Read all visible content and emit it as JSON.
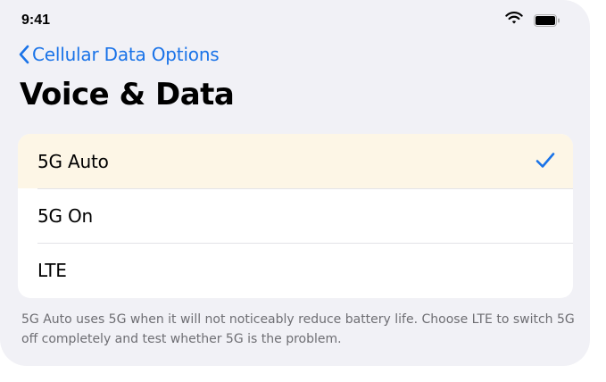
{
  "status_bar": {
    "time": "9:41",
    "icons": [
      "wifi-icon",
      "battery-icon"
    ]
  },
  "nav": {
    "back_label": "Cellular Data Options",
    "back_icon": "chevron-left-icon"
  },
  "page": {
    "title": "Voice & Data"
  },
  "options": [
    {
      "label": "5G Auto",
      "selected": true
    },
    {
      "label": "5G On",
      "selected": false
    },
    {
      "label": "LTE",
      "selected": false
    }
  ],
  "footer": {
    "note": "5G Auto uses 5G when it will not noticeably reduce battery life. Choose LTE to switch 5G off completely and test whether 5G is the problem."
  },
  "colors": {
    "accent": "#1a73e8",
    "background": "#f1f1f6",
    "selected_row": "#fdf6e6",
    "footer_text": "#6e6e73"
  }
}
